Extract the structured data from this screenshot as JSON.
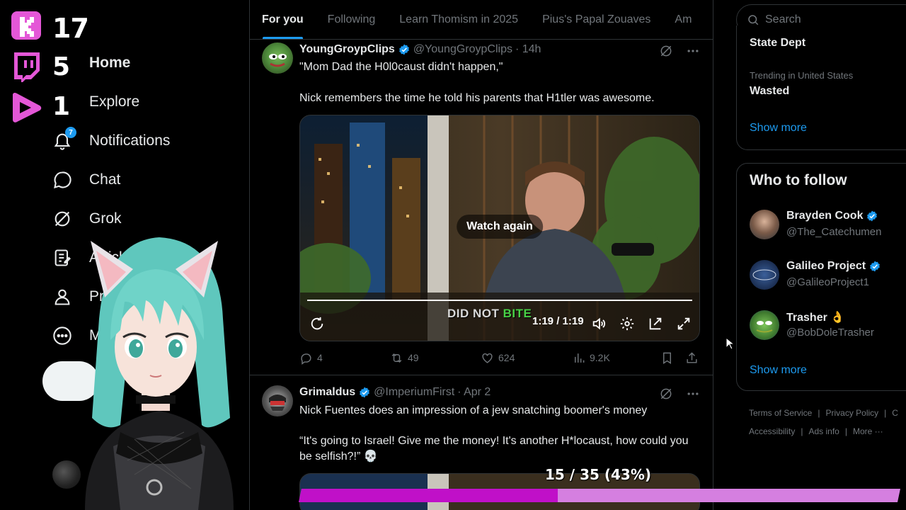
{
  "overlay": {
    "platforms": [
      {
        "name": "kick",
        "count": "17",
        "color": "#e457d7"
      },
      {
        "name": "twitch",
        "count": "5",
        "color": "#e457d7"
      },
      {
        "name": "kick-play",
        "count": "1",
        "color": "#e457d7"
      }
    ],
    "goal": {
      "label": "15 / 35 (43%)",
      "progress": 0.43
    }
  },
  "nav": {
    "items": [
      {
        "label": "Home",
        "icon": "home-icon"
      },
      {
        "label": "Explore",
        "icon": "search-icon"
      },
      {
        "label": "Notifications",
        "icon": "bell-icon",
        "badge": "7"
      },
      {
        "label": "Chat",
        "icon": "chat-icon"
      },
      {
        "label": "Grok",
        "icon": "grok-icon"
      },
      {
        "label": "Articles",
        "icon": "article-icon"
      },
      {
        "label": "Profile",
        "icon": "person-icon"
      },
      {
        "label": "More",
        "icon": "more-circle-icon"
      }
    ]
  },
  "tabs": [
    "For you",
    "Following",
    "Learn Thomism in 2025",
    "Pius's Papal Zouaves",
    "Am"
  ],
  "tweets": [
    {
      "name": "YoungGroypClips",
      "handle": "@YoungGroypClips",
      "time": "· 14h",
      "text1": "\"Mom Dad the H0l0caust didn't happen,\"",
      "text2": "Nick remembers the time he told his parents that H1tler was awesome.",
      "video": {
        "overlay": "Watch again",
        "time": "1:19 / 1:19",
        "caption_a": "DID NOT",
        "caption_b": "BITE"
      },
      "stats": {
        "replies": "4",
        "reposts": "49",
        "likes": "624",
        "views": "9.2K"
      }
    },
    {
      "name": "Grimaldus",
      "handle": "@ImperiumFirst",
      "time": "· Apr 2",
      "text1": "Nick Fuentes does an impression of a jew snatching boomer's money",
      "text2": "“It's going to Israel! Give me the money! It's another H*locaust, how could you be selfish?!” 💀"
    }
  ],
  "right": {
    "search_placeholder": "Search",
    "trends": [
      {
        "meta": "",
        "name": "State Dept"
      },
      {
        "meta": "Trending in United States",
        "name": "Wasted"
      }
    ],
    "trends_show_more": "Show more",
    "who_to_follow": {
      "title": "Who to follow",
      "accounts": [
        {
          "name": "Brayden Cook",
          "handle": "@The_Catechumen",
          "verified": true
        },
        {
          "name": "Galileo Project",
          "handle": "@GalileoProject1",
          "verified": true
        },
        {
          "name": "Trasher 👌",
          "handle": "@BobDoleTrasher",
          "verified": false
        }
      ],
      "show_more": "Show more"
    },
    "footer": {
      "row1": [
        "Terms of Service",
        "Privacy Policy",
        "C"
      ],
      "row2": [
        "Accessibility",
        "Ads info",
        "More ···"
      ]
    }
  },
  "colors": {
    "accent": "#1d9bf0",
    "background": "#000000",
    "goal_fill": "#c010c8",
    "goal_track": "#d57fe0"
  }
}
